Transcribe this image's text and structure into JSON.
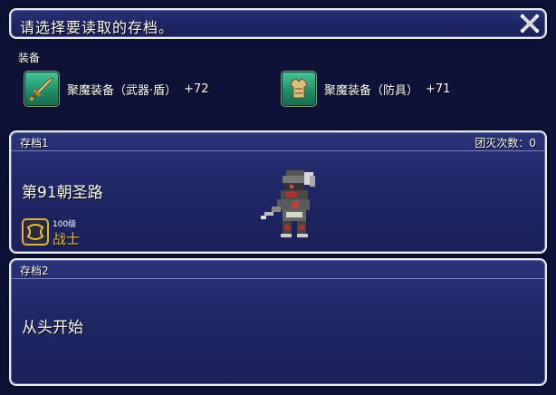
{
  "header": {
    "title": "请选择要读取的存档。"
  },
  "equipment": {
    "label": "装备",
    "weapon": {
      "name": "聚魔装备（武器·盾）",
      "bonus": "+72",
      "icon": "sword-icon"
    },
    "armor": {
      "name": "聚魔装备（防具）",
      "bonus": "+71",
      "icon": "armor-icon"
    }
  },
  "slots": [
    {
      "title": "存档1",
      "wipe_count": "团灭次数：0",
      "location": "第91朝圣路",
      "job_level": "100级",
      "job_name": "战士"
    },
    {
      "title": "存档2",
      "status": "从头开始"
    }
  ],
  "colors": {
    "panel": "#1f2766",
    "border": "#e8ecf4",
    "accent": "#f0c040"
  }
}
